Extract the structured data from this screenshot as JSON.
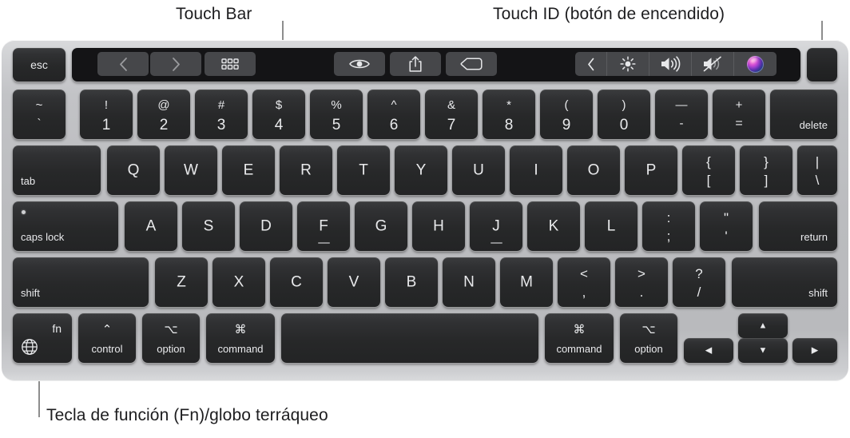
{
  "callouts": [
    {
      "id": "touch-bar",
      "label": "Touch Bar"
    },
    {
      "id": "touch-id",
      "label": "Touch ID (botón de encendido)"
    },
    {
      "id": "fn-globe",
      "label": "Tecla de función (Fn)/globo terráqueo"
    }
  ],
  "colors": {
    "key_face": "#2a2b2d",
    "key_text": "#e9eaec",
    "chassis": "#bbbcbf",
    "touchbar_bg": "#141416",
    "touchbar_button": "#46474a",
    "leader_line": "#8d8d8d",
    "caption_text": "#1d1d1f"
  },
  "touch_bar": {
    "left_buttons": [
      {
        "name": "back-icon",
        "label": "‹"
      },
      {
        "name": "forward-icon",
        "label": "›"
      },
      {
        "name": "grid-icon",
        "label": "grid"
      }
    ],
    "center_buttons": [
      {
        "name": "eye-icon",
        "label": "eye"
      },
      {
        "name": "share-icon",
        "label": "share"
      },
      {
        "name": "tag-icon",
        "label": "tag"
      }
    ],
    "control_strip": [
      {
        "name": "expand-chevron-icon",
        "label": "‹"
      },
      {
        "name": "brightness-icon",
        "label": "brightness"
      },
      {
        "name": "volume-icon",
        "label": "volume"
      },
      {
        "name": "mute-icon",
        "label": "mute"
      },
      {
        "name": "siri-icon",
        "label": "Siri"
      }
    ]
  },
  "keyboard": {
    "esc": {
      "label": "esc"
    },
    "touch_id": {
      "label": ""
    },
    "row_numbers": [
      {
        "top": "~",
        "bottom": "`"
      },
      {
        "top": "!",
        "bottom": "1"
      },
      {
        "top": "@",
        "bottom": "2"
      },
      {
        "top": "#",
        "bottom": "3"
      },
      {
        "top": "$",
        "bottom": "4"
      },
      {
        "top": "%",
        "bottom": "5"
      },
      {
        "top": "^",
        "bottom": "6"
      },
      {
        "top": "&",
        "bottom": "7"
      },
      {
        "top": "*",
        "bottom": "8"
      },
      {
        "top": "(",
        "bottom": "9"
      },
      {
        "top": ")",
        "bottom": "0"
      },
      {
        "top": "—",
        "bottom": "-"
      },
      {
        "top": "+",
        "bottom": "="
      }
    ],
    "delete": {
      "label": "delete"
    },
    "tab": {
      "label": "tab"
    },
    "row_q": [
      "Q",
      "W",
      "E",
      "R",
      "T",
      "Y",
      "U",
      "I",
      "O",
      "P"
    ],
    "row_q_tail": [
      {
        "top": "{",
        "bottom": "["
      },
      {
        "top": "}",
        "bottom": "]"
      },
      {
        "top": "|",
        "bottom": "\\"
      }
    ],
    "caps_lock": {
      "label": "caps lock"
    },
    "row_a": [
      "A",
      "S",
      "D",
      "F",
      "G",
      "H",
      "J",
      "K",
      "L"
    ],
    "row_a_tail": [
      {
        "top": ":",
        "bottom": ";"
      },
      {
        "top": "\"",
        "bottom": "'"
      }
    ],
    "return": {
      "label": "return"
    },
    "shift_left": {
      "label": "shift"
    },
    "row_z": [
      "Z",
      "X",
      "C",
      "V",
      "B",
      "N",
      "M"
    ],
    "row_z_tail": [
      {
        "top": "<",
        "bottom": ","
      },
      {
        "top": ">",
        "bottom": "."
      },
      {
        "top": "?",
        "bottom": "/"
      }
    ],
    "shift_right": {
      "label": "shift"
    },
    "fn": {
      "label": "fn",
      "icon": "globe-icon"
    },
    "control": {
      "symbol": "⌃",
      "label": "control"
    },
    "option_left": {
      "symbol": "⌥",
      "label": "option"
    },
    "command_left": {
      "symbol": "⌘",
      "label": "command"
    },
    "space": {
      "label": ""
    },
    "command_right": {
      "symbol": "⌘",
      "label": "command"
    },
    "option_right": {
      "symbol": "⌥",
      "label": "option"
    },
    "arrow_left": {
      "label": "◀"
    },
    "arrow_up": {
      "label": "▲"
    },
    "arrow_down": {
      "label": "▼"
    },
    "arrow_right": {
      "label": "▶"
    }
  }
}
